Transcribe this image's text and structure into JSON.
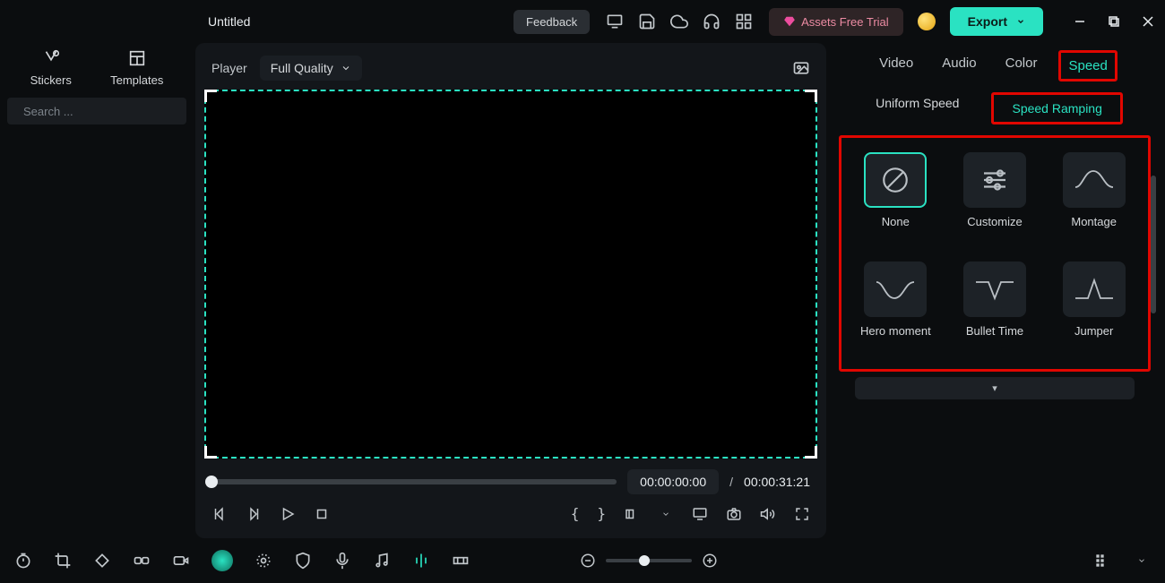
{
  "topbar": {
    "project_title": "Untitled",
    "feedback_label": "Feedback",
    "trial_label": "Assets Free Trial",
    "export_label": "Export"
  },
  "left": {
    "tab_stickers": "Stickers",
    "tab_templates": "Templates",
    "search_placeholder": "Search ..."
  },
  "player": {
    "label": "Player",
    "quality": "Full Quality",
    "current_time": "00:00:00:00",
    "separator": "/",
    "total_time": "00:00:31:21"
  },
  "right": {
    "tab_video": "Video",
    "tab_audio": "Audio",
    "tab_color": "Color",
    "tab_speed": "Speed",
    "sub_uniform": "Uniform Speed",
    "sub_ramping": "Speed Ramping",
    "presets": {
      "none": "None",
      "customize": "Customize",
      "montage": "Montage",
      "hero": "Hero moment",
      "bullet": "Bullet Time",
      "jumper": "Jumper"
    },
    "expand_arrow": "▾"
  }
}
